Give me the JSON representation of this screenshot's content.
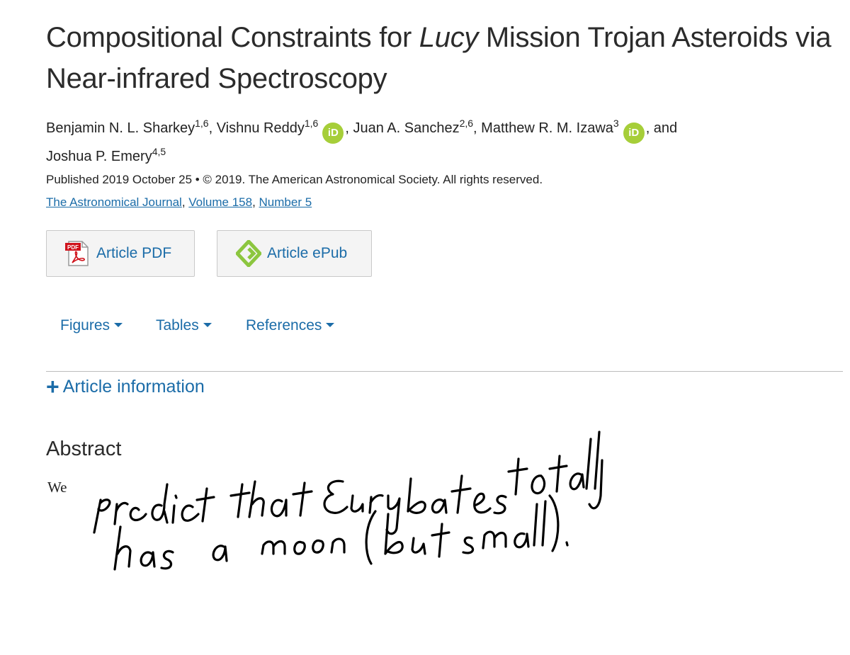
{
  "title": {
    "part1": "Compositional Constraints for ",
    "italic": "Lucy",
    "part2": " Mission Trojan Asteroids via Near-infrared Spectroscopy"
  },
  "authors": [
    {
      "name": "Benjamin N. L. Sharkey",
      "sup": "1,6"
    },
    {
      "name": "Vishnu Reddy",
      "sup": "1,6"
    },
    {
      "name": "Juan A. Sanchez",
      "sup": "2,6"
    },
    {
      "name": "Matthew R. M. Izawa",
      "sup": "3"
    },
    {
      "name": "Joshua P. Emery",
      "sup": "4,5"
    }
  ],
  "authors_and": ", and",
  "orcid_label": "iD",
  "published": "Published 2019 October 25 • © 2019. The American Astronomical Society. All rights reserved.",
  "journal": {
    "name": "The Astronomical Journal",
    "volume": "Volume 158",
    "number": "Number 5"
  },
  "buttons": {
    "pdf": "Article PDF",
    "epub": "Article ePub",
    "pdf_icon_text": "PDF"
  },
  "tabs": [
    "Figures",
    "Tables",
    "References"
  ],
  "article_info": "Article information",
  "abstract": {
    "heading": "Abstract",
    "text": "We"
  },
  "handwritten_note": "predict that Eurybates totally has a moon (but small).",
  "colors": {
    "link": "#1b6ca8",
    "orcid": "#a6ce39",
    "pdf_red": "#d0121b",
    "epub_green": "#8cc63f"
  }
}
